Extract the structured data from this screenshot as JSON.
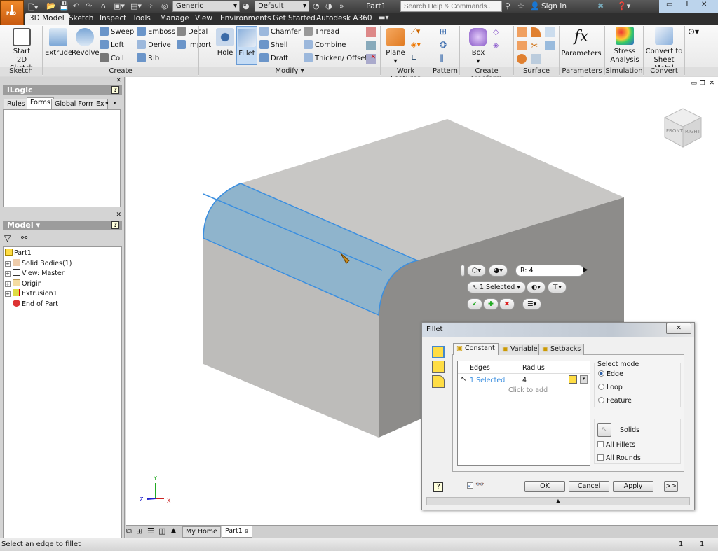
{
  "app": {
    "logo_text": "I",
    "edition": "PRO",
    "document_title": "Part1",
    "material_combo": "Generic",
    "appearance_combo": "Default",
    "search_placeholder": "Search Help & Commands...",
    "sign_in": "Sign In"
  },
  "ribbon_tabs": [
    "3D Model",
    "Sketch",
    "Inspect",
    "Tools",
    "Manage",
    "View",
    "Environments",
    "Get Started",
    "Autodesk A360"
  ],
  "active_tab": "3D Model",
  "ribbon": {
    "sketch": {
      "start_line1": "Start",
      "start_line2": "2D Sketch",
      "label": "Sketch"
    },
    "create": {
      "extrude": "Extrude",
      "revolve": "Revolve",
      "sweep": "Sweep",
      "loft": "Loft",
      "coil": "Coil",
      "emboss": "Emboss",
      "derive": "Derive",
      "rib": "Rib",
      "decal": "Decal",
      "import": "Import",
      "label": "Create"
    },
    "modify": {
      "hole": "Hole",
      "fillet": "Fillet",
      "chamfer": "Chamfer",
      "shell": "Shell",
      "draft": "Draft",
      "thread": "Thread",
      "combine": "Combine",
      "thicken": "Thicken/ Offset",
      "label": "Modify ▾"
    },
    "work_features": {
      "plane": "Plane",
      "label": "Work Features"
    },
    "pattern": {
      "label": "Pattern"
    },
    "freeform": {
      "box": "Box",
      "label": "Create Freeform"
    },
    "surface": {
      "label": "Surface"
    },
    "parameters": {
      "button": "Parameters",
      "label": "Parameters ▾",
      "glyph": "fx"
    },
    "simulation": {
      "line1": "Stress",
      "line2": "Analysis",
      "label": "Simulation"
    },
    "convert": {
      "line1": "Convert to",
      "line2": "Sheet Metal",
      "label": "Convert"
    }
  },
  "ilogic": {
    "title": "iLogic",
    "tabs": [
      "Rules",
      "Forms",
      "Global Forms",
      "Ex"
    ],
    "active_tab": "Forms"
  },
  "model": {
    "title": "Model ▾",
    "tree": [
      {
        "label": "Part1",
        "expandable": false,
        "icon": "part-icon"
      },
      {
        "label": "Solid Bodies(1)",
        "expandable": true,
        "icon": "solid-bodies-icon"
      },
      {
        "label": "View: Master",
        "expandable": true,
        "icon": "view-icon"
      },
      {
        "label": "Origin",
        "expandable": true,
        "icon": "folder-icon"
      },
      {
        "label": "Extrusion1",
        "expandable": true,
        "icon": "extrusion-icon"
      },
      {
        "label": "End of Part",
        "expandable": false,
        "icon": "end-of-part-icon"
      }
    ]
  },
  "viewcube": {
    "front": "FRONT",
    "right": "RIGHT"
  },
  "triad": {
    "x": "X",
    "y": "Y",
    "z": "Z"
  },
  "mini_toolbar": {
    "radius_label": "R:",
    "radius_value": "4",
    "selection": "1 Selected"
  },
  "fillet_dialog": {
    "title": "Fillet",
    "tabs": [
      "Constant",
      "Variable",
      "Setbacks"
    ],
    "active_tab": "Constant",
    "columns": [
      "Edges",
      "Radius"
    ],
    "rows": [
      {
        "edges": "1 Selected",
        "radius": "4"
      }
    ],
    "click_to_add": "Click to add",
    "select_mode": {
      "label": "Select mode",
      "options": [
        "Edge",
        "Loop",
        "Feature"
      ],
      "selected": "Edge"
    },
    "solids": "Solids",
    "all_fillets": "All Fillets",
    "all_rounds": "All Rounds",
    "all_fillets_checked": false,
    "all_rounds_checked": false,
    "preview_checked": true,
    "buttons": {
      "ok": "OK",
      "cancel": "Cancel",
      "apply": "Apply",
      "more": ">>"
    }
  },
  "document_tabs": [
    "My Home",
    "Part1"
  ],
  "active_document_tab": "Part1",
  "status": {
    "message": "Select an edge to fillet",
    "count1": "1",
    "count2": "1"
  },
  "colors": {
    "selection_blue": "#3b8fe0",
    "fillet_face": "#8fb4cc",
    "app_orange": "#e07a20"
  }
}
